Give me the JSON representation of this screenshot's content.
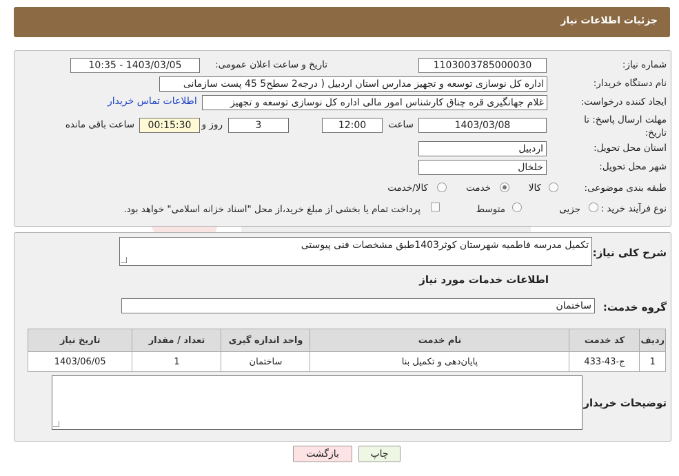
{
  "header": {
    "title": "جزئیات اطلاعات نیاز"
  },
  "labels": {
    "need_number": "شماره نیاز:",
    "announce_datetime": "تاریخ و ساعت اعلان عمومی:",
    "buyer_org": "نام دستگاه خریدار:",
    "creator": "ایجاد کننده درخواست:",
    "deadline_line1": "مهلت ارسال پاسخ: تا",
    "deadline_line2": "تاریخ:",
    "hour": "ساعت",
    "day_and": "روز و",
    "hours_remaining": "ساعت باقی مانده",
    "province": "استان محل تحویل:",
    "city": "شهر محل تحویل:",
    "category": "طبقه بندی موضوعی:",
    "purchase_type": "نوع فرآیند خرید :",
    "general_desc": "شرح کلی نیاز:",
    "services_info": "اطلاعات خدمات مورد نیاز",
    "service_group": "گروه خدمت:",
    "buyer_notes": "توضیحات خریدار:"
  },
  "values": {
    "need_number": "1103003785000030",
    "announce_datetime": "1403/03/05 - 10:35",
    "buyer_org": "اداره کل نوسازی   توسعه و تجهیز مدارس استان اردبیل ( درجه2  سطح5  45 پست سازمانی",
    "creator": "غلام جهانگیری قره چناق کارشناس امور مالی اداره کل نوسازی   توسعه و تجهیز",
    "contact_link": "اطلاعات تماس خریدار",
    "deadline_date": "1403/03/08",
    "deadline_time": "12:00",
    "days": "3",
    "remaining_time": "00:15:30",
    "province": "اردبیل",
    "city": "خلخال",
    "general_desc": "تکمیل مدرسه فاطمیه شهرستان کوثر1403طبق مشخصات فنی پیوستی",
    "service_group": "ساختمان",
    "buyer_notes": ""
  },
  "category_options": [
    "کالا",
    "خدمت",
    "کالا/خدمت"
  ],
  "category_selected": "خدمت",
  "purchase_options": [
    "جزیی",
    "متوسط"
  ],
  "purchase_note": "پرداخت تمام یا بخشی از مبلغ خرید،از محل \"اسناد خزانه اسلامی\" خواهد بود.",
  "table": {
    "headers": [
      "ردیف",
      "کد خدمت",
      "نام خدمت",
      "واحد اندازه گیری",
      "تعداد / مقدار",
      "تاریخ نیاز"
    ],
    "rows": [
      [
        "1",
        "ج-43-433",
        "پایان‌دهی و تکمیل بنا",
        "ساختمان",
        "1",
        "1403/06/05"
      ]
    ]
  },
  "buttons": {
    "print": "چاپ",
    "back": "بازگشت"
  },
  "colors": {
    "header": "#8b6a44",
    "link": "#1a3fc4",
    "back_button": "#fde3e3",
    "print_button": "#eef6e4"
  }
}
